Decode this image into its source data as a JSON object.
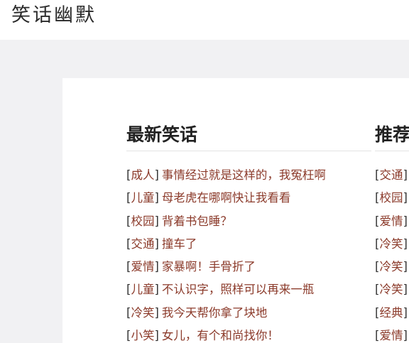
{
  "site": {
    "logo_text": "笑话幽默"
  },
  "latest": {
    "title": "最新笑话",
    "items": [
      {
        "category": "成人",
        "title": "事情经过就是这样的，我冤枉啊"
      },
      {
        "category": "儿童",
        "title": "母老虎在哪啊快让我看看"
      },
      {
        "category": "校园",
        "title": "背着书包睡？"
      },
      {
        "category": "交通",
        "title": "撞车了"
      },
      {
        "category": "爱情",
        "title": "家暴啊！手骨折了"
      },
      {
        "category": "儿童",
        "title": "不认识字，照样可以再来一瓶"
      },
      {
        "category": "冷笑",
        "title": "我今天帮你拿了块地"
      },
      {
        "category": "小笑",
        "title": "女儿，有个和尚找你！"
      }
    ]
  },
  "recommended": {
    "title": "推荐",
    "items": [
      {
        "category": "交通"
      },
      {
        "category": "校园"
      },
      {
        "category": "爱情"
      },
      {
        "category": "冷笑"
      },
      {
        "category": "冷笑"
      },
      {
        "category": "冷笑"
      },
      {
        "category": "经典"
      },
      {
        "category": "爱情"
      }
    ]
  },
  "colors": {
    "link": "#8b3a2a",
    "band": "#f1f1f3"
  }
}
